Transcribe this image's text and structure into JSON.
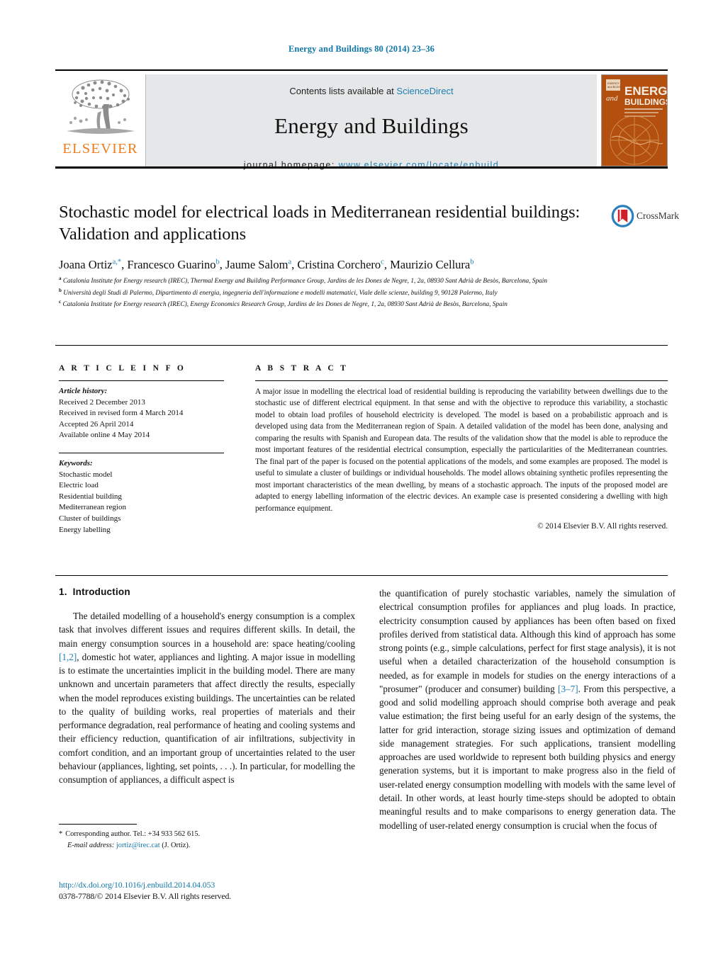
{
  "running_head": "Energy and Buildings 80 (2014) 23–36",
  "banner": {
    "publisher_name": "ELSEVIER",
    "contents_prefix": "Contents lists available at ",
    "contents_link": "ScienceDirect",
    "journal_title": "Energy and Buildings",
    "homepage_label": "journal homepage: ",
    "homepage_url": "www.elsevier.com/locate/enbuild",
    "cover": {
      "line1": "ENERGY",
      "line2": "and",
      "line3": "BUILDINGS",
      "bg_color": "#b4500f"
    },
    "link_color": "#1f7fb5",
    "elsevier_color": "#f07d1a"
  },
  "article": {
    "title": "Stochastic model for electrical loads in Mediterranean residential buildings: Validation and applications",
    "authors": [
      {
        "name": "Joana Ortiz",
        "marks": "a,*"
      },
      {
        "name": "Francesco Guarino",
        "marks": "b"
      },
      {
        "name": "Jaume Salom",
        "marks": "a"
      },
      {
        "name": "Cristina Corchero",
        "marks": "c"
      },
      {
        "name": "Maurizio Cellura",
        "marks": "b"
      }
    ],
    "affiliations": [
      {
        "mark": "a",
        "text": "Catalonia Institute for Energy research (IREC), Thermal Energy and Building Performance Group, Jardins de les Dones de Negre, 1, 2a, 08930 Sant Adrià de Besòs, Barcelona, Spain"
      },
      {
        "mark": "b",
        "text": "Università degli Studi di Palermo, Dipartimento di energia, ingegneria dell'informazione e modelli matematici, Viale delle scienze, building 9, 90128 Palermo, Italy"
      },
      {
        "mark": "c",
        "text": "Catalonia Institute for Energy research (IREC), Energy Economics Research Group, Jardins de les Dones de Negre, 1, 2a, 08930 Sant Adrià de Besòs, Barcelona, Spain"
      }
    ],
    "crossmark_label": "CrossMark"
  },
  "article_info": {
    "heading": "A R T I C L E   I N F O",
    "history_label": "Article history:",
    "history": [
      "Received 2 December 2013",
      "Received in revised form 4 March 2014",
      "Accepted 26 April 2014",
      "Available online 4 May 2014"
    ],
    "keywords_label": "Keywords:",
    "keywords": [
      "Stochastic model",
      "Electric load",
      "Residential building",
      "Mediterranean region",
      "Cluster of buildings",
      "Energy labelling"
    ]
  },
  "abstract": {
    "heading": "A B S T R A C T",
    "text": "A major issue in modelling the electrical load of residential building is reproducing the variability between dwellings due to the stochastic use of different electrical equipment. In that sense and with the objective to reproduce this variability, a stochastic model to obtain load profiles of household electricity is developed. The model is based on a probabilistic approach and is developed using data from the Mediterranean region of Spain. A detailed validation of the model has been done, analysing and comparing the results with Spanish and European data. The results of the validation show that the model is able to reproduce the most important features of the residential electrical consumption, especially the particularities of the Mediterranean countries. The final part of the paper is focused on the potential applications of the models, and some examples are proposed. The model is useful to simulate a cluster of buildings or individual households. The model allows obtaining synthetic profiles representing the most important characteristics of the mean dwelling, by means of a stochastic approach. The inputs of the proposed model are adapted to energy labelling information of the electric devices. An example case is presented considering a dwelling with high performance equipment.",
    "copyright": "© 2014 Elsevier B.V. All rights reserved."
  },
  "body": {
    "section_number": "1.",
    "section_title": "Introduction",
    "left_para_1": "The detailed modelling of a household's energy consumption is a complex task that involves different issues and requires different skills. In detail, the main energy consumption sources in a household are: space heating/cooling ",
    "left_cite_1": "[1,2]",
    "left_para_1b": ", domestic hot water, appliances and lighting. A major issue in modelling is to estimate the uncertainties implicit in the building model. There are many unknown and uncertain parameters that affect directly the results, especially when the model reproduces existing buildings. The uncertainties can be related to the quality of building works, real properties of materials and their performance degradation, real performance of heating and cooling systems and their efficiency reduction, quantification of air infiltrations, subjectivity in comfort condition, and an important group of uncertainties related to the user behaviour (appliances, lighting, set points, . . .). In particular, for modelling the consumption of appliances, a difficult aspect is",
    "right_para_1": "the quantification of purely stochastic variables, namely the simulation of electrical consumption profiles for appliances and plug loads. In practice, electricity consumption caused by appliances has been often based on fixed profiles derived from statistical data. Although this kind of approach has some strong points (e.g., simple calculations, perfect for first stage analysis), it is not useful when a detailed characterization of the household consumption is needed, as for example in models for studies on the energy interactions of a \"prosumer\" (producer and consumer) building ",
    "right_cite_1": "[3–7]",
    "right_para_1b": ". From this perspective, a good and solid modelling approach should comprise both average and peak value estimation; the first being useful for an early design of the systems, the latter for grid interaction, storage sizing issues and optimization of demand side management strategies. For such applications, transient modelling approaches are used worldwide to represent both building physics and energy generation systems, but it is important to make progress also in the field of user-related energy consumption modelling with models with the same level of detail. In other words, at least hourly time-steps should be adopted to obtain meaningful results and to make comparisons to energy generation data. The modelling of user-related energy consumption is crucial when the focus of"
  },
  "footnote": {
    "star": "*",
    "corresponding": "Corresponding author. Tel.: +34 933 562 615.",
    "email_label": "E-mail address:",
    "email": "jortiz@irec.cat",
    "email_suffix": "(J. Ortiz)."
  },
  "footer": {
    "doi": "http://dx.doi.org/10.1016/j.enbuild.2014.04.053",
    "issn": "0378-7788/© 2014 Elsevier B.V. All rights reserved."
  }
}
